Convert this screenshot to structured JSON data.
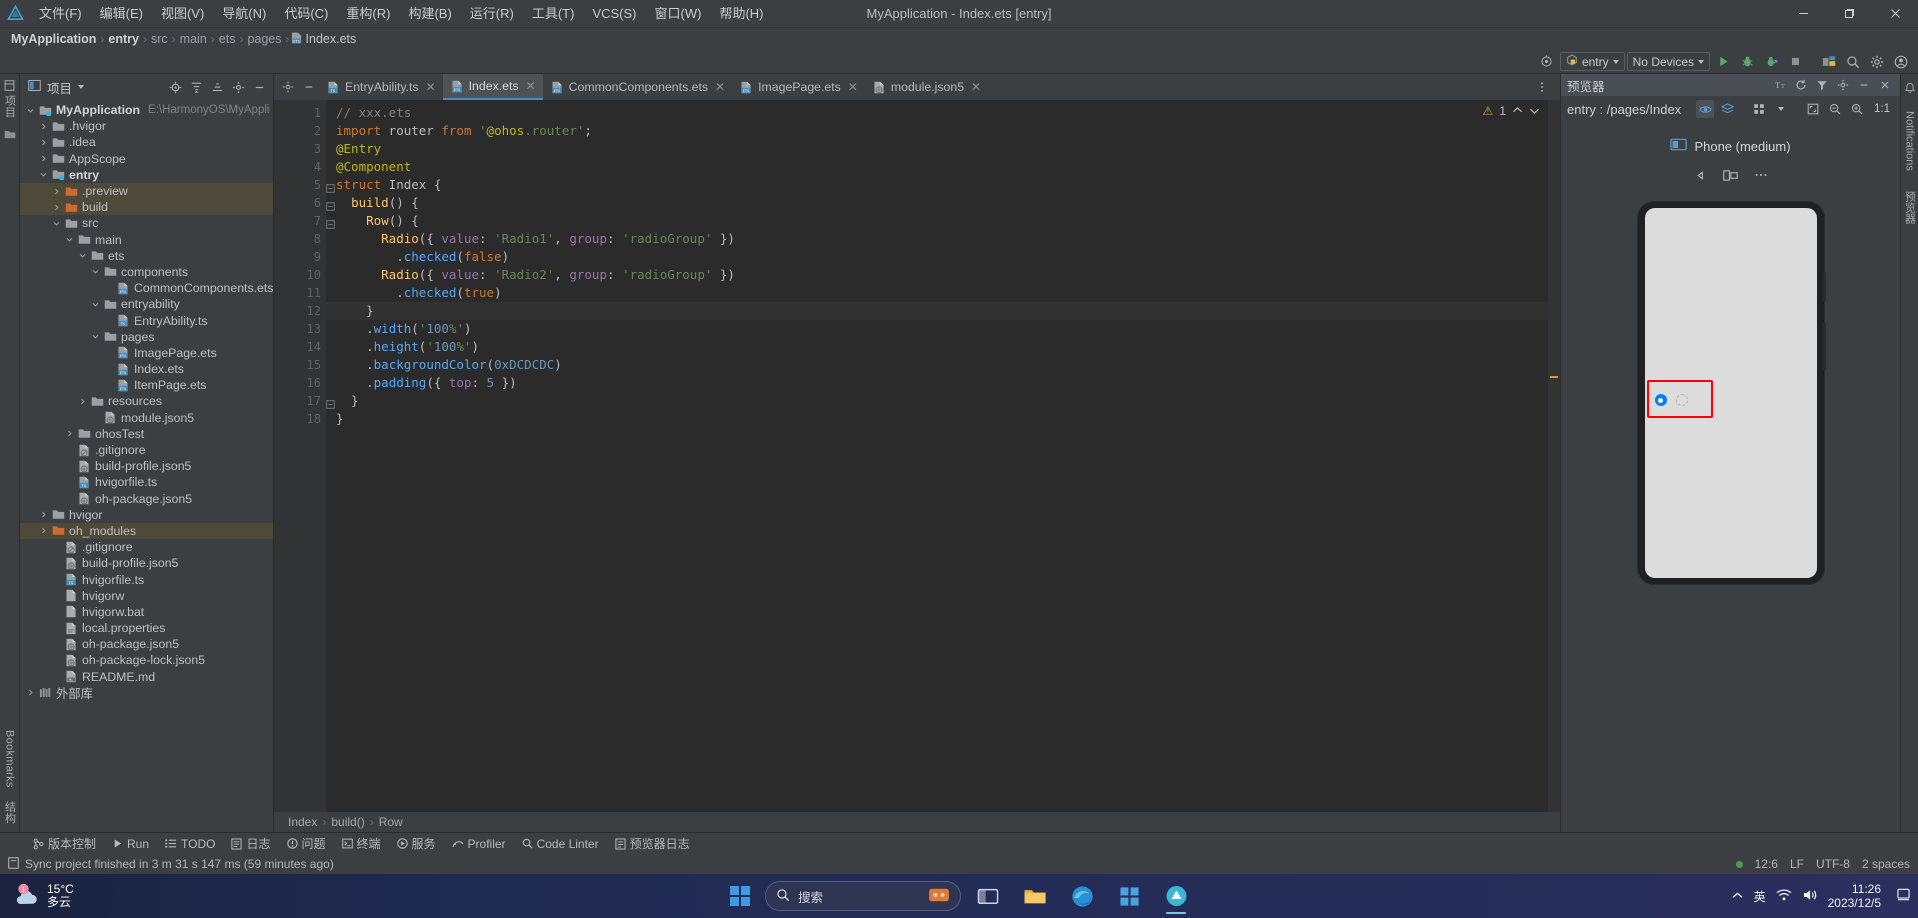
{
  "window": {
    "title": "MyApplication - Index.ets [entry]",
    "minimize": "—",
    "maximize": "❐",
    "close": "✕"
  },
  "menubar": {
    "logo": "deveco-logo-icon",
    "items": [
      {
        "label": "文件(F)"
      },
      {
        "label": "编辑(E)"
      },
      {
        "label": "视图(V)"
      },
      {
        "label": "导航(N)"
      },
      {
        "label": "代码(C)"
      },
      {
        "label": "重构(R)"
      },
      {
        "label": "构建(B)"
      },
      {
        "label": "运行(R)"
      },
      {
        "label": "工具(T)"
      },
      {
        "label": "VCS(S)"
      },
      {
        "label": "窗口(W)"
      },
      {
        "label": "帮助(H)"
      }
    ]
  },
  "breadcrumb": {
    "items": [
      "MyApplication",
      "entry",
      "src",
      "main",
      "ets",
      "pages"
    ],
    "file": "Index.ets",
    "separator": "›"
  },
  "toolbar": {
    "target_selector": "entry",
    "device_selector": "No Devices",
    "icons": [
      "settings-target-icon",
      "run-icon",
      "debug-icon",
      "profile-run-icon",
      "stop-icon",
      "device-manager-icon",
      "search-everywhere-icon",
      "settings-gear-icon",
      "account-icon"
    ]
  },
  "left_rail": {
    "top_label": "项目",
    "bottom_labels": [
      "Bookmarks",
      "结构"
    ]
  },
  "project_panel": {
    "title": "项目",
    "header_icons": [
      "locate-icon",
      "expand-all-icon",
      "collapse-all-icon",
      "settings-icon",
      "hide-icon"
    ],
    "tree": [
      {
        "depth": 0,
        "arrow": "down",
        "icon": "module-folder",
        "label": "MyApplication",
        "bold": true,
        "path": "E:\\HarmonyOS\\MyApplicatio",
        "highlight": false
      },
      {
        "depth": 1,
        "arrow": "right",
        "icon": "folder",
        "label": ".hvigor",
        "bold": false,
        "path": "",
        "highlight": false
      },
      {
        "depth": 1,
        "arrow": "right",
        "icon": "folder",
        "label": ".idea",
        "bold": false,
        "path": "",
        "highlight": false
      },
      {
        "depth": 1,
        "arrow": "right",
        "icon": "folder",
        "label": "AppScope",
        "bold": false,
        "path": "",
        "highlight": false
      },
      {
        "depth": 1,
        "arrow": "down",
        "icon": "module-folder",
        "label": "entry",
        "bold": true,
        "path": "",
        "highlight": false
      },
      {
        "depth": 2,
        "arrow": "right",
        "icon": "folder-orange",
        "label": ".preview",
        "bold": false,
        "path": "",
        "highlight": true
      },
      {
        "depth": 2,
        "arrow": "right",
        "icon": "folder-orange",
        "label": "build",
        "bold": false,
        "path": "",
        "highlight": true
      },
      {
        "depth": 2,
        "arrow": "down",
        "icon": "folder",
        "label": "src",
        "bold": false,
        "path": "",
        "highlight": false
      },
      {
        "depth": 3,
        "arrow": "down",
        "icon": "folder",
        "label": "main",
        "bold": false,
        "path": "",
        "highlight": false
      },
      {
        "depth": 4,
        "arrow": "down",
        "icon": "folder",
        "label": "ets",
        "bold": false,
        "path": "",
        "highlight": false
      },
      {
        "depth": 5,
        "arrow": "down",
        "icon": "folder",
        "label": "components",
        "bold": false,
        "path": "",
        "highlight": false
      },
      {
        "depth": 6,
        "arrow": "none",
        "icon": "ets-file",
        "label": "CommonComponents.ets",
        "bold": false,
        "path": "",
        "highlight": false
      },
      {
        "depth": 5,
        "arrow": "down",
        "icon": "folder",
        "label": "entryability",
        "bold": false,
        "path": "",
        "highlight": false
      },
      {
        "depth": 6,
        "arrow": "none",
        "icon": "ts-file",
        "label": "EntryAbility.ts",
        "bold": false,
        "path": "",
        "highlight": false
      },
      {
        "depth": 5,
        "arrow": "down",
        "icon": "folder",
        "label": "pages",
        "bold": false,
        "path": "",
        "highlight": false
      },
      {
        "depth": 6,
        "arrow": "none",
        "icon": "ets-file",
        "label": "ImagePage.ets",
        "bold": false,
        "path": "",
        "highlight": false
      },
      {
        "depth": 6,
        "arrow": "none",
        "icon": "ets-file",
        "label": "Index.ets",
        "bold": false,
        "path": "",
        "highlight": false
      },
      {
        "depth": 6,
        "arrow": "none",
        "icon": "ets-file",
        "label": "ItemPage.ets",
        "bold": false,
        "path": "",
        "highlight": false
      },
      {
        "depth": 4,
        "arrow": "right",
        "icon": "folder",
        "label": "resources",
        "bold": false,
        "path": "",
        "highlight": false
      },
      {
        "depth": 5,
        "arrow": "none",
        "icon": "json5-file",
        "label": "module.json5",
        "bold": false,
        "path": "",
        "highlight": false
      },
      {
        "depth": 3,
        "arrow": "right",
        "icon": "folder",
        "label": "ohosTest",
        "bold": false,
        "path": "",
        "highlight": false
      },
      {
        "depth": 3,
        "arrow": "none",
        "icon": "gitignore-file",
        "label": ".gitignore",
        "bold": false,
        "path": "",
        "highlight": false
      },
      {
        "depth": 3,
        "arrow": "none",
        "icon": "json5-file",
        "label": "build-profile.json5",
        "bold": false,
        "path": "",
        "highlight": false
      },
      {
        "depth": 3,
        "arrow": "none",
        "icon": "ts-file",
        "label": "hvigorfile.ts",
        "bold": false,
        "path": "",
        "highlight": false
      },
      {
        "depth": 3,
        "arrow": "none",
        "icon": "json5-file",
        "label": "oh-package.json5",
        "bold": false,
        "path": "",
        "highlight": false
      },
      {
        "depth": 1,
        "arrow": "right",
        "icon": "folder",
        "label": "hvigor",
        "bold": false,
        "path": "",
        "highlight": false
      },
      {
        "depth": 1,
        "arrow": "right",
        "icon": "folder-orange",
        "label": "oh_modules",
        "bold": false,
        "path": "",
        "highlight": true
      },
      {
        "depth": 2,
        "arrow": "none",
        "icon": "gitignore-file",
        "label": ".gitignore",
        "bold": false,
        "path": "",
        "highlight": false
      },
      {
        "depth": 2,
        "arrow": "none",
        "icon": "json5-file",
        "label": "build-profile.json5",
        "bold": false,
        "path": "",
        "highlight": false
      },
      {
        "depth": 2,
        "arrow": "none",
        "icon": "ts-file",
        "label": "hvigorfile.ts",
        "bold": false,
        "path": "",
        "highlight": false
      },
      {
        "depth": 2,
        "arrow": "none",
        "icon": "file",
        "label": "hvigorw",
        "bold": false,
        "path": "",
        "highlight": false
      },
      {
        "depth": 2,
        "arrow": "none",
        "icon": "file",
        "label": "hvigorw.bat",
        "bold": false,
        "path": "",
        "highlight": false
      },
      {
        "depth": 2,
        "arrow": "none",
        "icon": "props-file",
        "label": "local.properties",
        "bold": false,
        "path": "",
        "highlight": false
      },
      {
        "depth": 2,
        "arrow": "none",
        "icon": "json5-file",
        "label": "oh-package.json5",
        "bold": false,
        "path": "",
        "highlight": false
      },
      {
        "depth": 2,
        "arrow": "none",
        "icon": "json5-file",
        "label": "oh-package-lock.json5",
        "bold": false,
        "path": "",
        "highlight": false
      },
      {
        "depth": 2,
        "arrow": "none",
        "icon": "md-file",
        "label": "README.md",
        "bold": false,
        "path": "",
        "highlight": false
      },
      {
        "depth": 0,
        "arrow": "right",
        "icon": "library-icon",
        "label": "外部库",
        "bold": false,
        "path": "",
        "highlight": false
      }
    ]
  },
  "editor": {
    "tabs": [
      {
        "label": "EntryAbility.ts",
        "icon": "ts-file",
        "active": false
      },
      {
        "label": "Index.ets",
        "icon": "ets-file",
        "active": true
      },
      {
        "label": "CommonComponents.ets",
        "icon": "ets-file",
        "active": false
      },
      {
        "label": "ImagePage.ets",
        "icon": "ets-file",
        "active": false
      },
      {
        "label": "module.json5",
        "icon": "json5-file",
        "active": false
      }
    ],
    "close_glyph": "✕",
    "inspection": {
      "warning_count": "1",
      "up": "⌃",
      "down": "⌄"
    },
    "line_numbers": [
      "1",
      "2",
      "3",
      "4",
      "5",
      "6",
      "7",
      "8",
      "9",
      "10",
      "11",
      "12",
      "13",
      "14",
      "15",
      "16",
      "17",
      "18"
    ],
    "current_line": 12,
    "code_lines": [
      "// xxx.ets",
      "import router from '@ohos.router';",
      "@Entry",
      "@Component",
      "struct Index {",
      "  build() {",
      "    Row() {",
      "      Radio({ value: 'Radio1', group: 'radioGroup' })",
      "        .checked(false)",
      "      Radio({ value: 'Radio2', group: 'radioGroup' })",
      "        .checked(true)",
      "    }",
      "    .width('100%')",
      "    .height('100%')",
      "    .backgroundColor(0xDCDCDC)",
      "    .padding({ top: 5 })",
      "  }",
      "}"
    ],
    "struct_breadcrumb": [
      "Index",
      "build()",
      "Row"
    ]
  },
  "preview": {
    "title": "预览器",
    "route": "entry : /pages/Index",
    "device_name": "Phone (medium)",
    "zoom_ratio": "1:1",
    "toolbar_icons": [
      "eye-icon",
      "layers-icon",
      "grid-icon",
      "chevron-down-icon",
      "fit-icon",
      "zoom-out-icon",
      "zoom-in-icon",
      "ratio-icon"
    ],
    "header_icons": [
      "refresh-icon",
      "filter-icon",
      "settings-icon",
      "minimize-icon",
      "close-icon",
      "text-size-icon"
    ],
    "device_controls": [
      "rotate-left-icon",
      "multi-device-icon",
      "more-icon"
    ],
    "radio_checked": "Radio2",
    "radio_unchecked": "Radio1"
  },
  "right_rail": {
    "labels": [
      "Notifications",
      "预览器"
    ]
  },
  "tool_windows": [
    {
      "label": "版本控制",
      "icon": "vcs-icon"
    },
    {
      "label": "Run",
      "icon": "run-icon"
    },
    {
      "label": "TODO",
      "icon": "todo-icon"
    },
    {
      "label": "日志",
      "icon": "log-icon"
    },
    {
      "label": "问题",
      "icon": "problems-icon"
    },
    {
      "label": "终端",
      "icon": "terminal-icon"
    },
    {
      "label": "服务",
      "icon": "services-icon"
    },
    {
      "label": "Profiler",
      "icon": "profiler-icon"
    },
    {
      "label": "Code Linter",
      "icon": "linter-icon"
    },
    {
      "label": "预览器日志",
      "icon": "preview-log-icon"
    }
  ],
  "statusbar": {
    "message": "Sync project finished in 3 m 31 s 147 ms (59 minutes ago)",
    "caret_position": "12:6",
    "line_separator": "LF",
    "encoding": "UTF-8",
    "indent": "2 spaces"
  },
  "taskbar": {
    "weather_temp": "15°C",
    "weather_desc": "多云",
    "weather_badge": "1",
    "search_placeholder": "搜索",
    "apps": [
      "file-explorer-icon",
      "folder-icon",
      "edge-icon",
      "store-icon",
      "cloud-app-icon"
    ],
    "tray_icons": [
      "chevron-up-icon",
      "ime-icon",
      "network-icon",
      "volume-icon"
    ],
    "ime_label": "英",
    "clock_time": "11:26",
    "clock_date": "2023/12/5"
  },
  "colors": {
    "accent_blue": "#4a88c7",
    "radio_blue": "#007dff",
    "annotation_red": "#ff0000",
    "warning_yellow": "#d6a62b",
    "folder_orange": "#cf6a34",
    "panel_bg": "#3c3f41",
    "editor_bg": "#2b2b2b"
  }
}
